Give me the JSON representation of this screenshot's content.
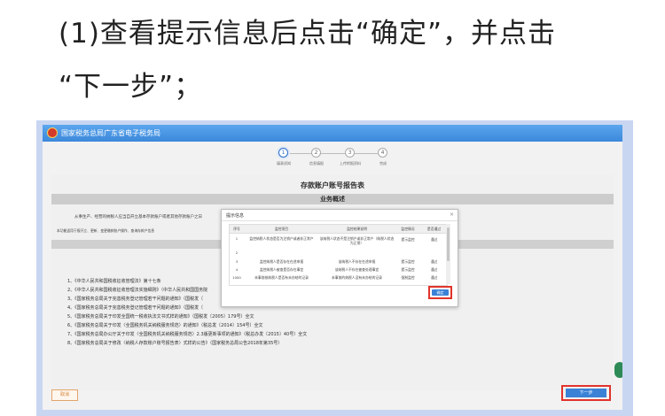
{
  "caption": {
    "line1": "(1)查看提示信息后点击“确定”，并点击",
    "line2": "“下一步”；"
  },
  "app": {
    "title": "国家税务总局广东省电子税务局"
  },
  "steps": [
    {
      "num": "1",
      "label": "填表须知"
    },
    {
      "num": "2",
      "label": "信息填报"
    },
    {
      "num": "3",
      "label": "上传附报资料"
    },
    {
      "num": "4",
      "label": "完成"
    }
  ],
  "report": {
    "title": "存款账户账号报告表",
    "section": "业务概述",
    "para1": "从事生产、经营的纳税人应当自开立基本存款账户或者其他存款账户之日",
    "para2": "本功能适用于报开立、更新、变更缴款账户操作、查询存款户信息"
  },
  "laws": [
    "1、《中华人民共和国税收征收管理法》第十七条",
    "2、《中华人民共和国税收征收管理法实施细则》（中华人民共和国国务院",
    "3、《国家税务总局关于完善税务登记管理若干问题的通知》（国税发〔",
    "4、《国家税务总局关于完善税务登记管理若干问题的通知》（国税发〔",
    "5、《国家税务总局关于印发全国统一税收执法文书式样的通知》（国税发〔2005〕179号）全文",
    "6、《国家税务总局关于印发〈全国税务机关纳税服务规范〉的通知》（税总发〔2014〕154号）全文",
    "7、《国家税务总局办公厅关于印发〈全国税务机关纳税服务规范〉2.3版更新事项的通知》（税总办发〔2015〕40号）全文",
    "8、《国家税务总局关于修改〈纳税人存款账户账号报告表〉式样的公告》（国家税务总局公告2018年第35号）"
  ],
  "modal": {
    "title": "提示信息",
    "close": "×",
    "headers": [
      "序号",
      "监控项目",
      "监控结果说明",
      "监控情况",
      "是否通过"
    ],
    "rows": [
      [
        "1",
        "监控纳税人状态是否为注销户或者非正常户",
        "该纳税人状态不是注销户或非正常户（纳税人状态为正常）",
        "提示监控",
        "通过"
      ],
      [
        "2",
        "",
        "",
        "",
        ""
      ],
      [
        "3",
        "监控纳税人是否存在在途申报",
        "该纳税人不存在在途申报",
        "提示监控",
        "通过"
      ],
      [
        "4",
        "监控纳税人被查是否存在事宜",
        "该纳税人不存在被查处理事宜",
        "提示监控",
        "通过"
      ],
      [
        "1000",
        "未事前核纳税人是否有未办结的记录",
        "未事前的纳税人没有未办结的记录",
        "强制监控",
        "通过"
      ]
    ],
    "confirm": "确定"
  },
  "buttons": {
    "prev": "取消",
    "next": "下一步"
  }
}
